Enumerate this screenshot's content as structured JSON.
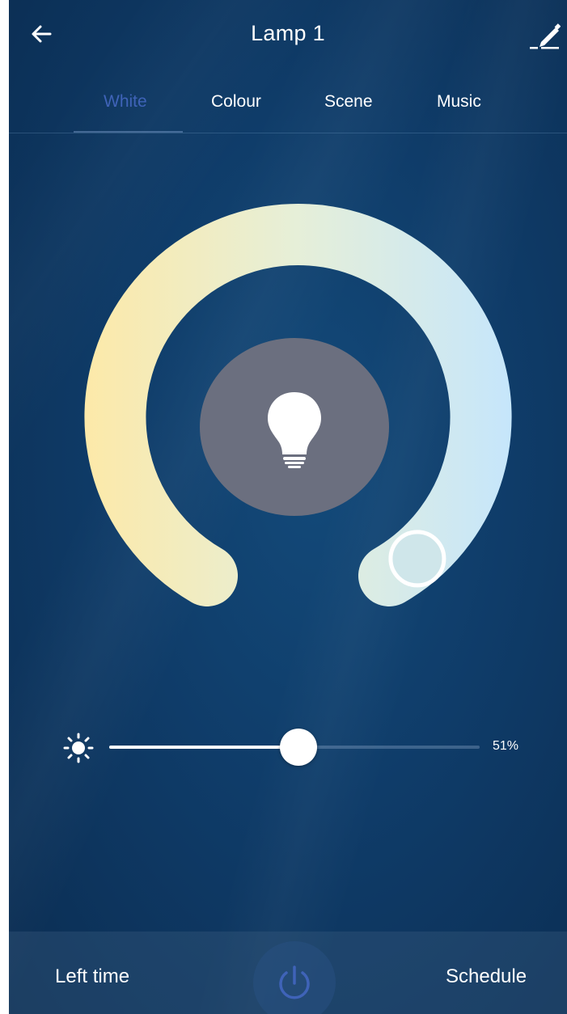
{
  "header": {
    "title": "Lamp 1",
    "back_icon": "back-arrow-icon",
    "edit_icon": "edit-pencil-icon"
  },
  "tabs": [
    {
      "label": "White",
      "active": true
    },
    {
      "label": "Colour",
      "active": false
    },
    {
      "label": "Scene",
      "active": false
    },
    {
      "label": "Music",
      "active": false
    }
  ],
  "temperature_dial": {
    "icon": "lightbulb-icon",
    "warm_color": "#fde9a8",
    "cool_color": "#c6e6fb",
    "value": 0.97
  },
  "brightness": {
    "icon": "sun-icon",
    "value": 51,
    "label": "51%"
  },
  "bottom_bar": {
    "left_time_label": "Left time",
    "schedule_label": "Schedule",
    "power_icon": "power-icon"
  },
  "colors": {
    "active_tab": "#3f63b8",
    "bulb_bg": "#6b6f7f",
    "power_icon": "#3f63b8"
  }
}
